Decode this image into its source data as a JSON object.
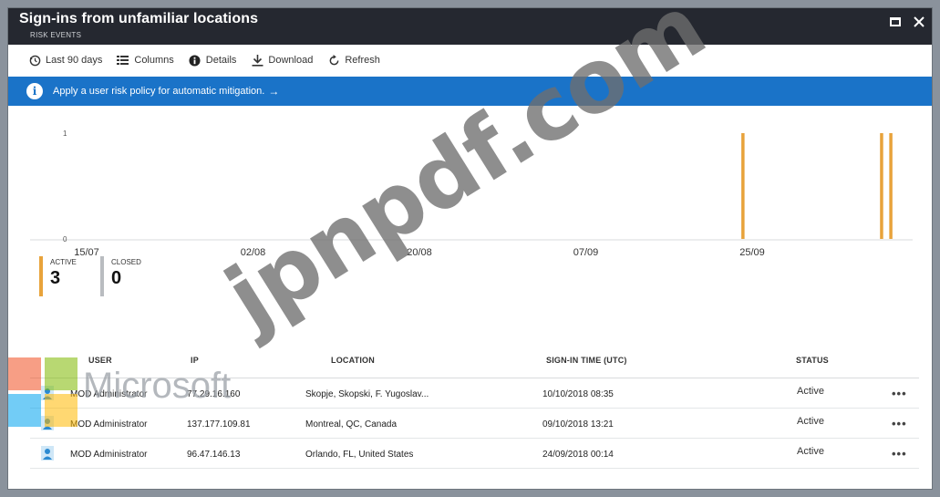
{
  "window": {
    "title": "Sign-ins from unfamiliar locations",
    "subtitle": "RISK EVENTS"
  },
  "toolbar": {
    "items": [
      {
        "label": "Last 90 days",
        "icon": "history-icon"
      },
      {
        "label": "Columns",
        "icon": "columns-icon"
      },
      {
        "label": "Details",
        "icon": "info-icon"
      },
      {
        "label": "Download",
        "icon": "download-icon"
      },
      {
        "label": "Refresh",
        "icon": "refresh-icon"
      }
    ]
  },
  "banner": {
    "text": "Apply a user risk policy for automatic mitigation.",
    "arrow": "→"
  },
  "chart_data": {
    "type": "bar",
    "x_ticks": [
      "15/07",
      "02/08",
      "20/08",
      "07/09",
      "25/09"
    ],
    "y_ticks": [
      "1",
      "0"
    ],
    "ylim": [
      0,
      1
    ],
    "series": [
      {
        "name": "ACTIVE",
        "color": "#e8a33b",
        "points": [
          {
            "x": "24/09",
            "y": 1
          },
          {
            "x": "09/10",
            "y": 1
          },
          {
            "x": "10/10",
            "y": 1
          }
        ]
      }
    ],
    "grid": false
  },
  "counters": {
    "active": {
      "label": "ACTIVE",
      "value": "3"
    },
    "closed": {
      "label": "CLOSED",
      "value": "0"
    }
  },
  "table": {
    "headers": {
      "user": "USER",
      "ip": "IP",
      "location": "LOCATION",
      "time": "SIGN-IN TIME (UTC)",
      "status": "STATUS"
    },
    "rows": [
      {
        "user": "MOD Administrator",
        "ip": "77.29.16.160",
        "location": "Skopje, Skopski, F. Yugoslav...",
        "time": "10/10/2018 08:35",
        "status": "Active",
        "more": "•••"
      },
      {
        "user": "MOD Administrator",
        "ip": "137.177.109.81",
        "location": "Montreal, QC, Canada",
        "time": "09/10/2018 13:21",
        "status": "Active",
        "more": "•••"
      },
      {
        "user": "MOD Administrator",
        "ip": "96.47.146.13",
        "location": "Orlando, FL, United States",
        "time": "24/09/2018 00:14",
        "status": "Active",
        "more": "•••"
      }
    ]
  },
  "overlays": {
    "brand": "Microsoft",
    "watermark": "jpnpdf.com"
  }
}
